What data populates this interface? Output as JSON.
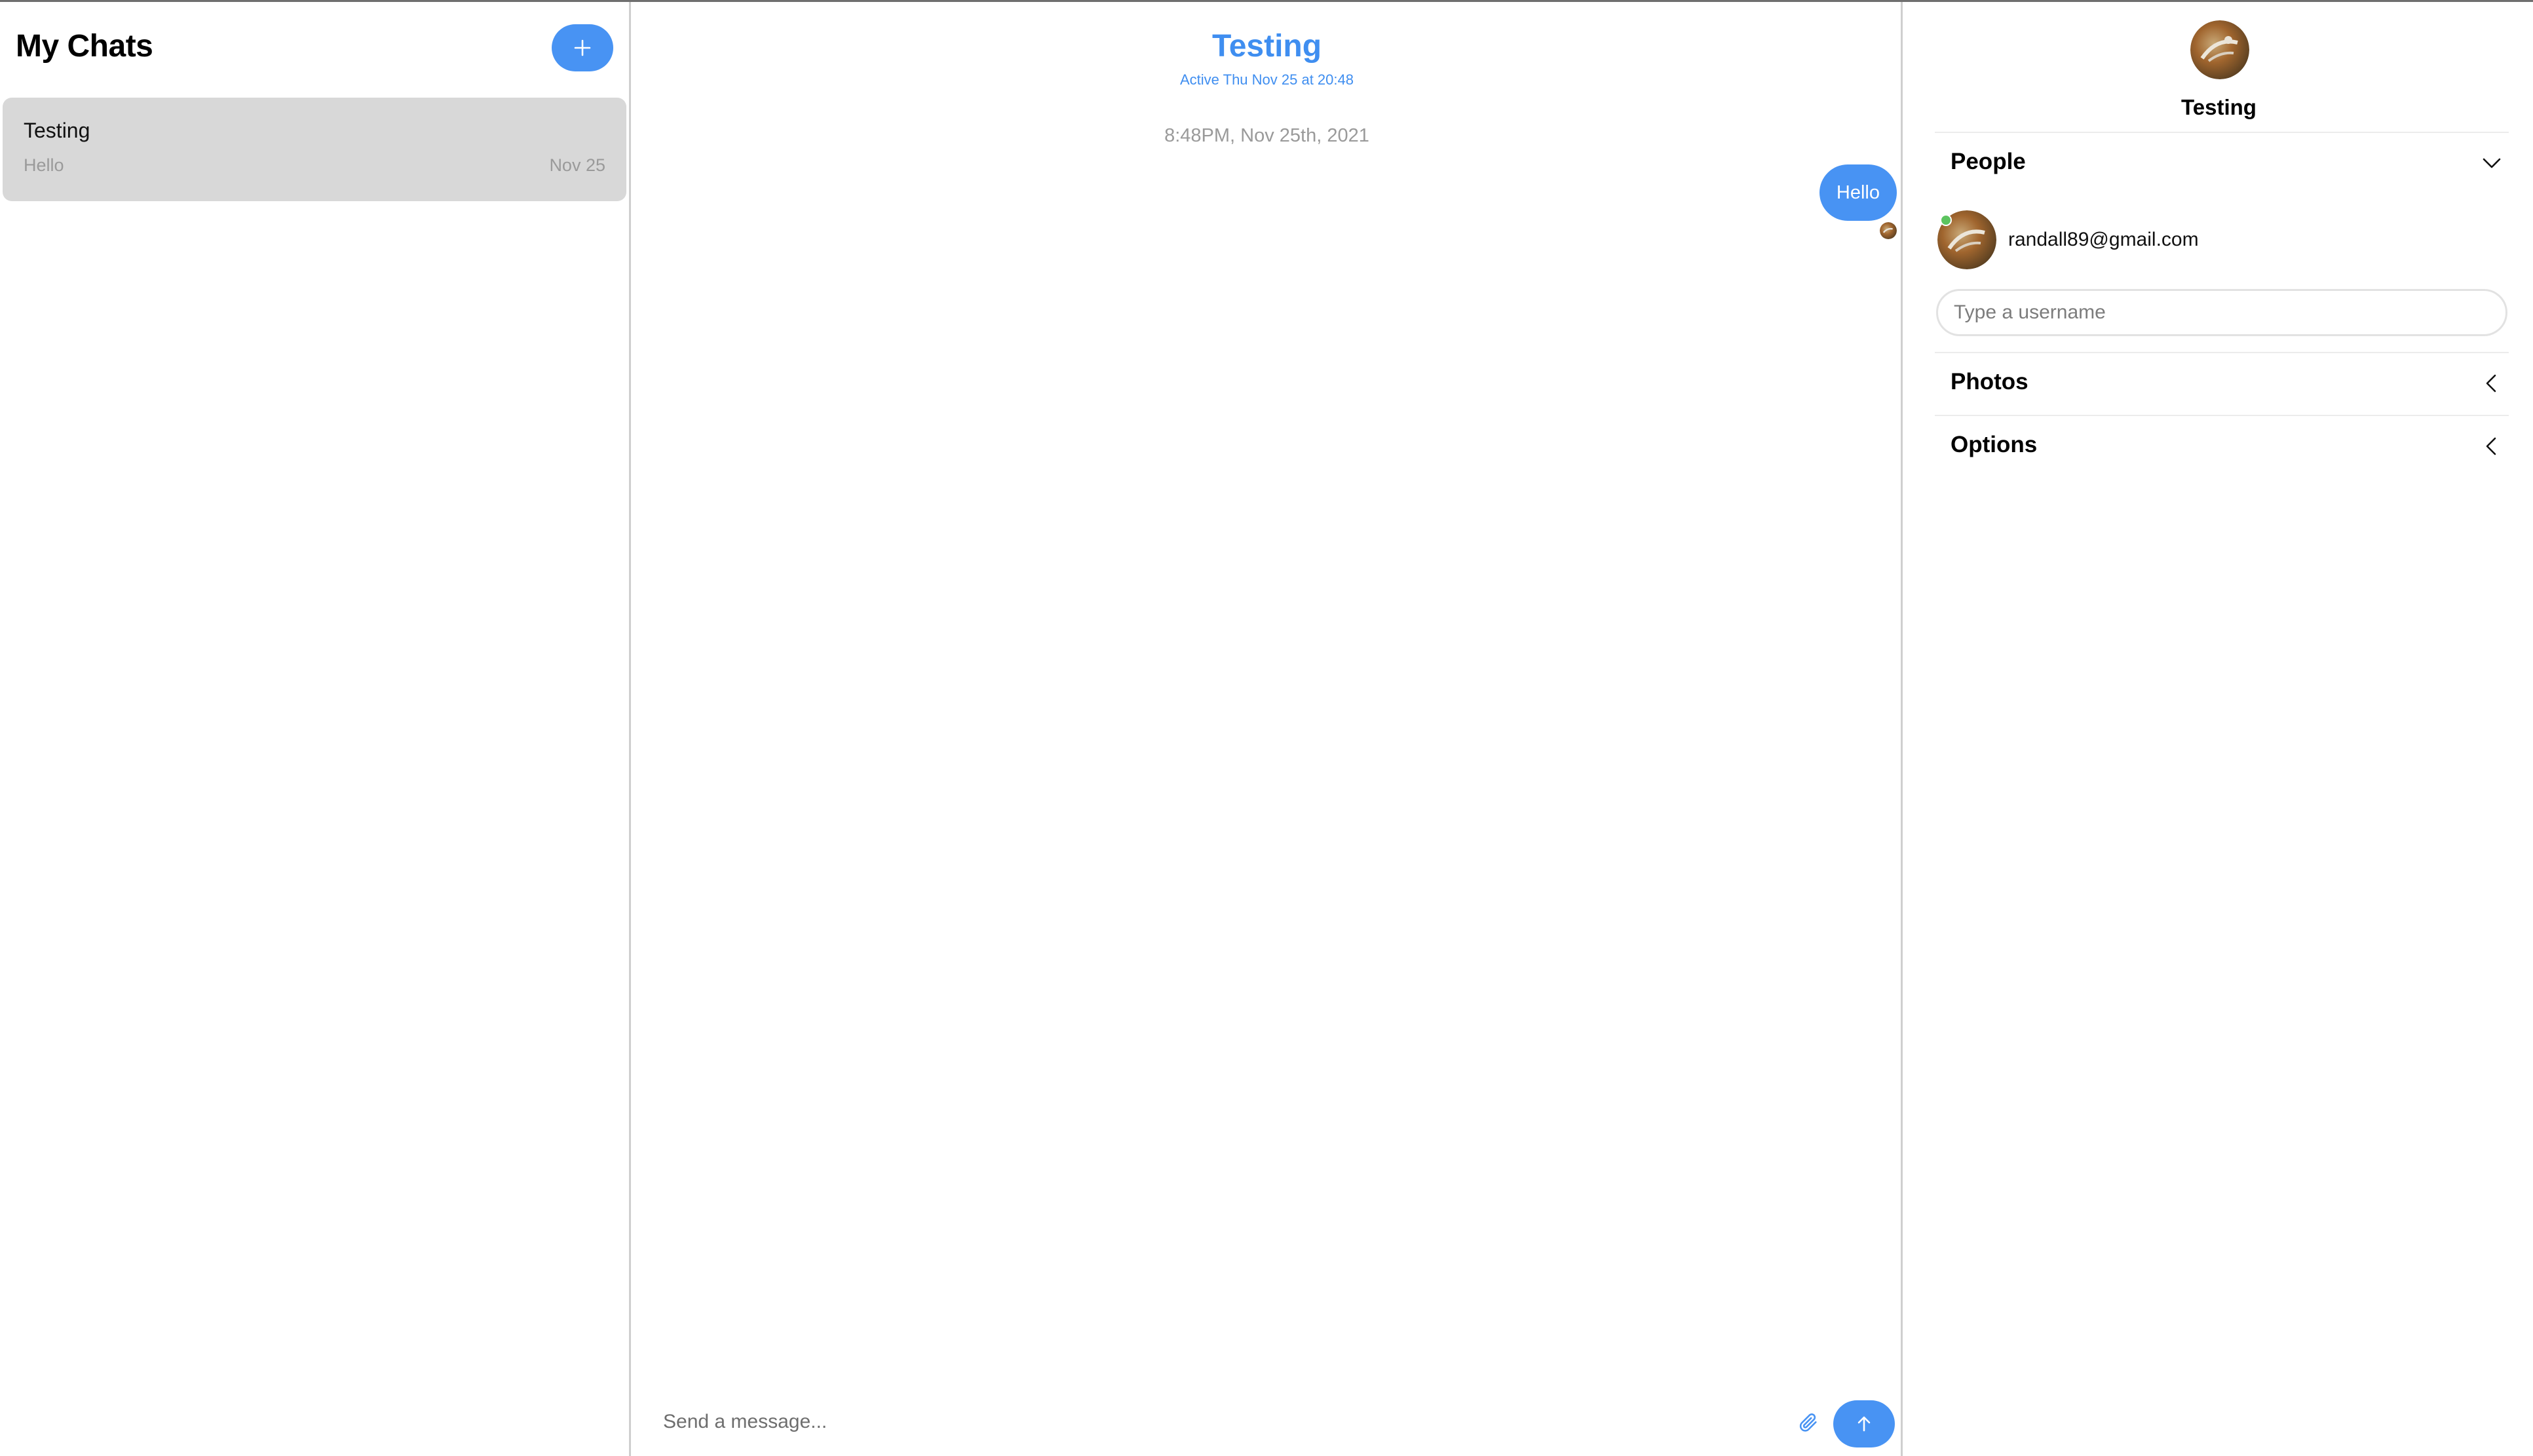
{
  "colors": {
    "accent": "#4893f3",
    "title_blue": "#3f8ef0",
    "card_gray": "#d8d8d8",
    "muted_text": "#9a9a9a",
    "online": "#5cc45f"
  },
  "sidebar": {
    "title": "My Chats",
    "new_chat_icon": "plus-icon",
    "chats": [
      {
        "title": "Testing",
        "preview": "Hello",
        "date": "Nov 25"
      }
    ]
  },
  "conversation": {
    "title": "Testing",
    "status": "Active Thu Nov 25 at 20:48",
    "timestamp": "8:48PM, Nov 25th, 2021",
    "messages": [
      {
        "text": "Hello",
        "from_me": true
      }
    ],
    "composer": {
      "placeholder": "Send a message...",
      "attach_icon": "paperclip-icon",
      "send_icon": "arrow-up-icon"
    }
  },
  "details": {
    "title": "Testing",
    "sections": {
      "people": {
        "label": "People",
        "icon": "chevron-down-icon"
      },
      "photos": {
        "label": "Photos",
        "icon": "chevron-left-icon"
      },
      "options": {
        "label": "Options",
        "icon": "chevron-left-icon"
      }
    },
    "people": [
      {
        "email": "randall89@gmail.com",
        "online": true
      }
    ],
    "add_user_placeholder": "Type a username"
  }
}
